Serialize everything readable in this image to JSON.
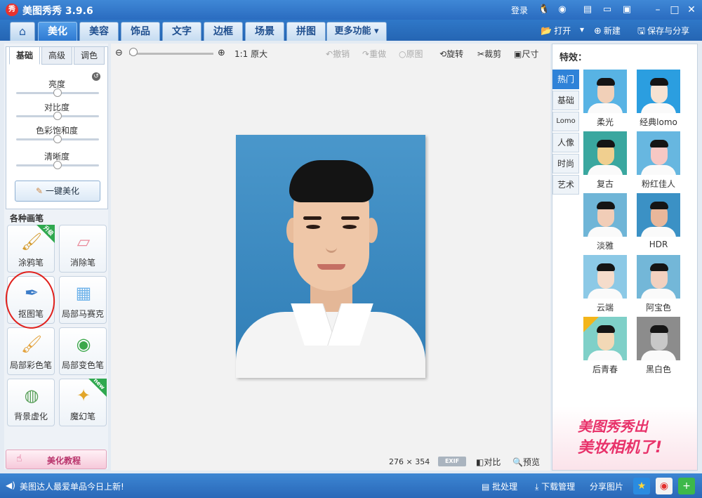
{
  "titlebar": {
    "logo": "秀",
    "title": "美图秀秀 3.9.6",
    "login": "登录",
    "icons": [
      "qq-icon",
      "weibo-icon",
      "skin-icon",
      "feedback-icon",
      "menu-icon"
    ],
    "window_controls": [
      "minimize-icon",
      "maximize-icon",
      "close-icon"
    ]
  },
  "menubar": {
    "home_icon": "home-icon",
    "tabs": [
      "美化",
      "美容",
      "饰品",
      "文字",
      "边框",
      "场景",
      "拼图"
    ],
    "active_tab": "美化",
    "more": "更多功能 ▾",
    "open": "打开",
    "open_dropdown": "▾",
    "new": "新建",
    "save_share": "保存与分享"
  },
  "left_panel": {
    "sub_tabs": [
      "基础",
      "高级",
      "调色"
    ],
    "active_sub_tab": "基础",
    "sliders": [
      {
        "label": "亮度",
        "value": 0.5
      },
      {
        "label": "对比度",
        "value": 0.5
      },
      {
        "label": "色彩饱和度",
        "value": 0.5
      },
      {
        "label": "清晰度",
        "value": 0.5
      }
    ],
    "one_click": "一键美化",
    "brushes_title": "各种画笔",
    "brushes": [
      {
        "label": "涂鸦笔",
        "badge": "升级"
      },
      {
        "label": "消除笔",
        "badge": ""
      },
      {
        "label": "抠图笔",
        "badge": ""
      },
      {
        "label": "局部马赛克",
        "badge": ""
      },
      {
        "label": "局部彩色笔",
        "badge": ""
      },
      {
        "label": "局部变色笔",
        "badge": ""
      },
      {
        "label": "背景虚化",
        "badge": ""
      },
      {
        "label": "魔幻笔",
        "badge": "new"
      }
    ],
    "tutorial": "美化教程"
  },
  "canvas": {
    "zoom_level": 0.0,
    "original_size": "1:1 原大",
    "tools": [
      {
        "label": "撤销",
        "icon": "undo-icon",
        "enabled": false
      },
      {
        "label": "重做",
        "icon": "redo-icon",
        "enabled": false
      },
      {
        "label": "原图",
        "icon": "original-icon",
        "enabled": false
      },
      {
        "label": "旋转",
        "icon": "rotate-icon",
        "enabled": true
      },
      {
        "label": "裁剪",
        "icon": "crop-icon",
        "enabled": true
      },
      {
        "label": "尺寸",
        "icon": "resize-icon",
        "enabled": true
      }
    ],
    "image_width": "276",
    "image_x": "×",
    "image_height": "354",
    "exif": "EXIF",
    "compare": "对比",
    "preview": "预览"
  },
  "right_panel": {
    "title": "特效：",
    "categories": [
      "热门",
      "基础",
      "Lomo",
      "人像",
      "时尚",
      "艺术"
    ],
    "active_category": "热门",
    "effects": [
      {
        "label": "柔光",
        "bg": "#58b3e4",
        "skin": "#f1d0b8"
      },
      {
        "label": "经典lomo",
        "bg": "#2b9ee0",
        "skin": "#f6e2d2"
      },
      {
        "label": "复古",
        "bg": "#3aa79f",
        "skin": "#f0cf8f"
      },
      {
        "label": "粉红佳人",
        "bg": "#67b7e0",
        "skin": "#f6c8c4"
      },
      {
        "label": "淡雅",
        "bg": "#6fb5d7",
        "skin": "#f1cdb7"
      },
      {
        "label": "HDR",
        "bg": "#3b91c5",
        "skin": "#e8b79b"
      },
      {
        "label": "云端",
        "bg": "#8cc9e6",
        "skin": "#f5dccb"
      },
      {
        "label": "阿宝色",
        "bg": "#73b7d8",
        "skin": "#f2d1c0"
      },
      {
        "label": "后青春",
        "bg": "#7fd0c8",
        "skin": "#f2d8b6",
        "badge": "会员"
      },
      {
        "label": "黑白色",
        "bg": "#8c8c8c",
        "skin": "#c8c8c8"
      }
    ],
    "promo_line1": "美图秀秀出",
    "promo_line2": "美妆相机了!"
  },
  "statusbar": {
    "news": "美图达人最爱单品今日上新!",
    "batch": "批处理",
    "download": "下载管理",
    "share": "分享图片"
  }
}
